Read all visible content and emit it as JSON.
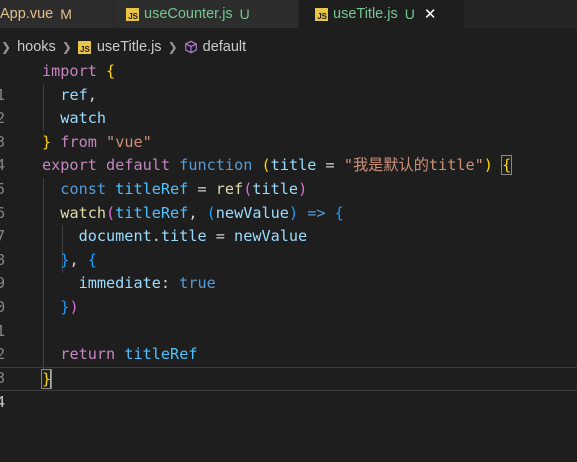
{
  "tabs": [
    {
      "file": "App.vue",
      "status": "M",
      "file_color": "#e2c08d",
      "status_color": "#e2c08d",
      "active": false
    },
    {
      "file": "useCounter.js",
      "status": "U",
      "file_color": "#73c991",
      "status_color": "#73c991",
      "active": false
    },
    {
      "file": "useTitle.js",
      "status": "U",
      "file_color": "#73c991",
      "status_color": "#73c991",
      "active": true
    }
  ],
  "breadcrumb": {
    "folder": "hooks",
    "file": "useTitle.js",
    "symbol": "default"
  },
  "editor": {
    "line_numbers": [
      "1",
      "2",
      "3",
      "4",
      "5",
      "6",
      "7",
      "8",
      "9",
      "0",
      "1",
      "2",
      "3",
      "4"
    ],
    "current_line": "4",
    "code": {
      "l1_import": "import",
      "l1_brace": "{",
      "l2_ref": "ref",
      "l2_comma": ",",
      "l3_watch": "watch",
      "l4_brace": "}",
      "l4_from": "from",
      "l4_vue": "\"vue\"",
      "l5_export": "export",
      "l5_default": "default",
      "l5_function": "function",
      "l5_paren_open": "(",
      "l5_title": "title",
      "l5_eq": " = ",
      "l5_str": "\"我是默认的title\"",
      "l5_paren_close": ")",
      "l5_brace": "{",
      "l6_const": "const",
      "l6_titleRef": "titleRef",
      "l6_eq": " = ",
      "l6_ref": "ref",
      "l6_po": "(",
      "l6_title": "title",
      "l6_pc": ")",
      "l7_watch": "watch",
      "l7_po": "(",
      "l7_titleRef": "titleRef",
      "l7_comma": ", ",
      "l7_po2": "(",
      "l7_newValue": "newValue",
      "l7_pc2": ")",
      "l7_arrow": " => ",
      "l7_brace": "{",
      "l8_document": "document",
      "l8_dot": ".",
      "l8_title": "title",
      "l8_eq": " = ",
      "l8_newValue": "newValue",
      "l9_brace": "}",
      "l9_comma": ", ",
      "l9_brace2": "{",
      "l10_immediate": "immediate",
      "l10_colon": ": ",
      "l10_true": "true",
      "l11_brace": "}",
      "l11_paren": ")",
      "l13_return": "return",
      "l13_titleRef": "titleRef",
      "l14_brace": "}"
    }
  },
  "colors": {
    "editor_bg": "#1e1e1e",
    "tabbar_bg": "#252526",
    "keyword": "#c586c0",
    "storage": "#569cd6",
    "variable": "#9cdcfe",
    "function": "#dcdcaa",
    "string": "#ce9178",
    "bracket_1": "#ffd700",
    "bracket_2": "#da70d6",
    "bracket_3": "#179fff"
  }
}
